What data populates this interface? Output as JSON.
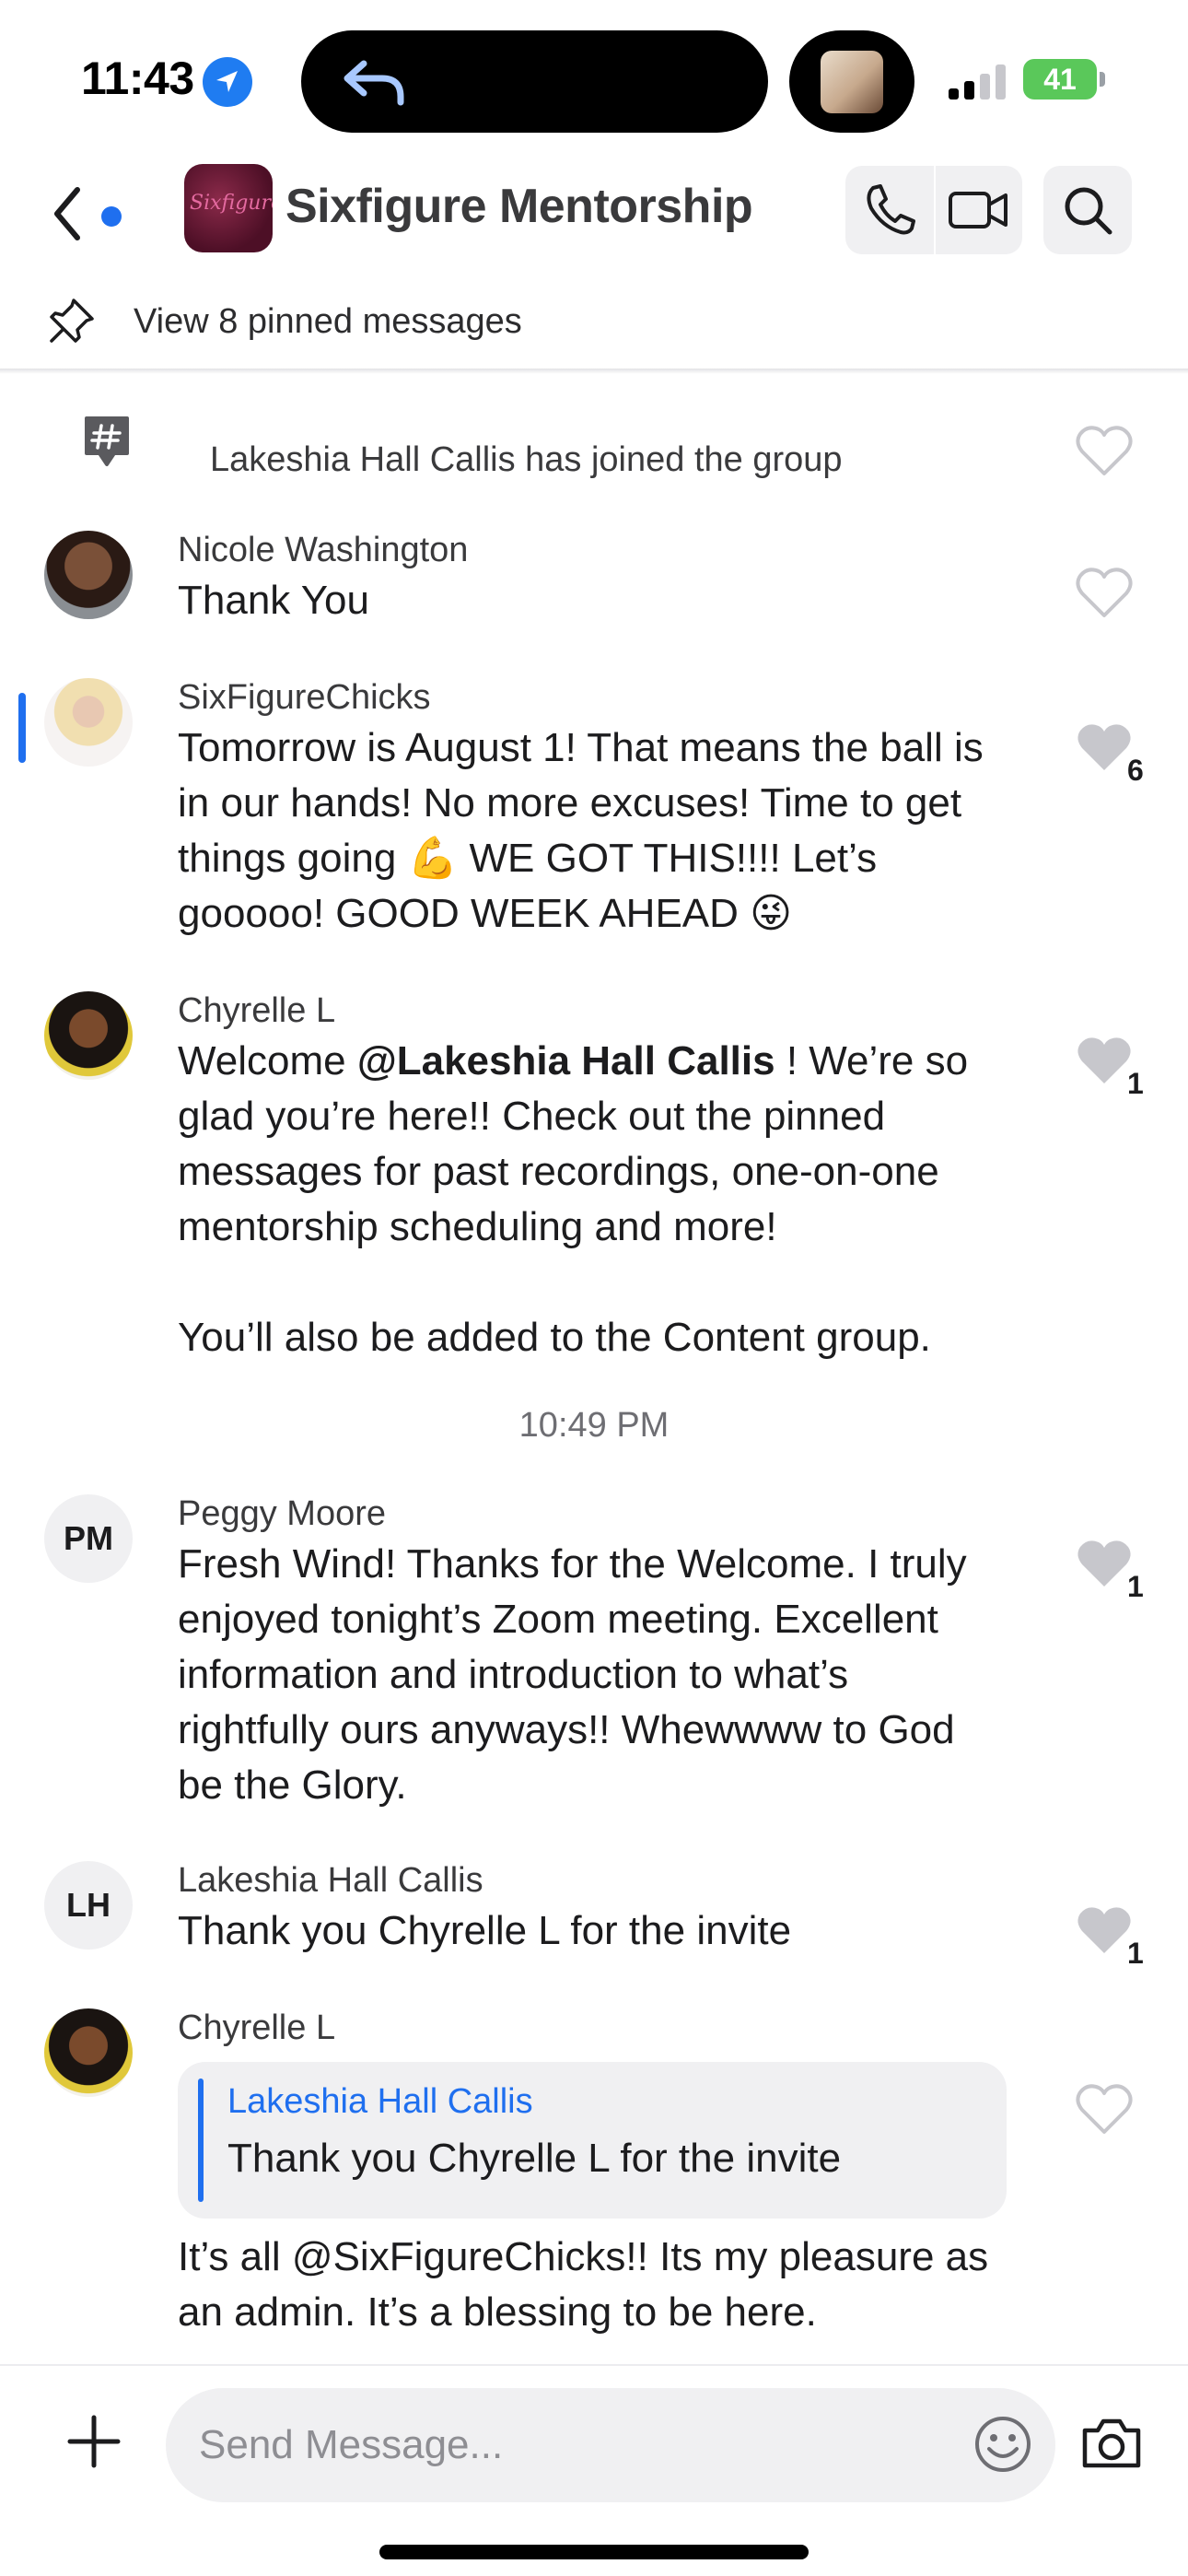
{
  "status_bar": {
    "time": "11:43",
    "battery": "41"
  },
  "header": {
    "group_name": "Sixfigure Mentorship",
    "avatar_text": "Sixfigure",
    "pinned_label": "View 8 pinned messages"
  },
  "system_message": "Lakeshia Hall Callis has joined the group",
  "messages": [
    {
      "sender": "Nicole Washington",
      "text": "Thank You",
      "likes": ""
    },
    {
      "sender": "SixFigureChicks",
      "lines": [
        "Tomorrow is August 1! That means the ball is",
        "in our hands! No more excuses! Time to get",
        "things going 💪 WE GOT THIS!!!! Let’s",
        "gooooo! GOOD WEEK AHEAD 😜"
      ],
      "likes": "6"
    },
    {
      "sender": "Chyrelle L",
      "mention": "@Lakeshia Hall Callis",
      "lines": [
        " ! We’re so",
        "glad you’re here!! Check out the pinned",
        "messages for past recordings, one-on-one",
        "mentorship scheduling and more!",
        "You’ll also be added to the Content group."
      ],
      "prefix": "Welcome ",
      "likes": "1"
    },
    {
      "sender": "Peggy Moore",
      "initials": "PM",
      "lines": [
        "Fresh Wind! Thanks for the Welcome. I truly",
        "enjoyed tonight’s Zoom meeting. Excellent",
        "information and introduction to what’s",
        "rightfully ours anyways!! Whewwww to God",
        "be the Glory."
      ],
      "likes": "1"
    },
    {
      "sender": "Lakeshia Hall Callis",
      "initials": "LH",
      "text": "Thank you Chyrelle L for the invite",
      "likes": "1"
    },
    {
      "sender": "Chyrelle L",
      "reply_to_author": "Lakeshia Hall Callis",
      "reply_to_text": "Thank you Chyrelle L for the invite",
      "lines": [
        "It’s all @SixFigureChicks!! Its my pleasure as",
        "an admin. It’s a blessing to be here."
      ],
      "likes": ""
    }
  ],
  "timestamp": "10:49 PM",
  "composer": {
    "placeholder": "Send Message..."
  },
  "colors": {
    "accent": "#1f6fef",
    "heart_gray": "#c7c7cc",
    "battery_green": "#5ac85a"
  }
}
